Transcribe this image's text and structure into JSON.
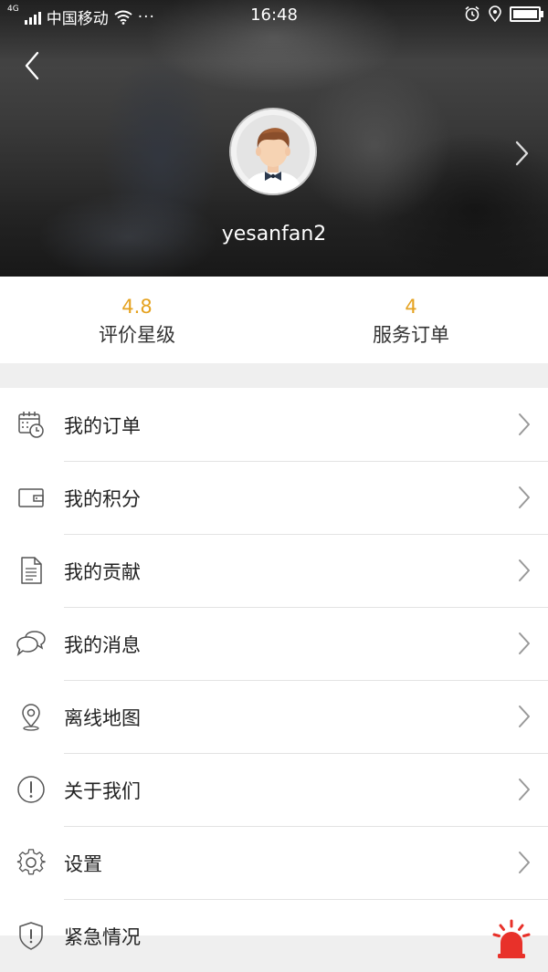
{
  "status_bar": {
    "network": "4G",
    "carrier": "中国移动",
    "dots": "···",
    "time": "16:48"
  },
  "profile": {
    "username": "yesanfan2"
  },
  "stats": [
    {
      "value": "4.8",
      "label": "评价星级"
    },
    {
      "value": "4",
      "label": "服务订单"
    }
  ],
  "menu": [
    {
      "label": "我的订单",
      "icon": "calendar-clock-icon"
    },
    {
      "label": "我的积分",
      "icon": "wallet-icon"
    },
    {
      "label": "我的贡献",
      "icon": "document-icon"
    },
    {
      "label": "我的消息",
      "icon": "chat-bubbles-icon"
    },
    {
      "label": "离线地图",
      "icon": "map-pin-icon"
    },
    {
      "label": "关于我们",
      "icon": "info-exclamation-icon"
    },
    {
      "label": "设置",
      "icon": "gear-icon"
    },
    {
      "label": "紧急情况",
      "icon": "shield-icon"
    }
  ],
  "colors": {
    "accent": "#e5a21f",
    "divider": "#e3e3e3",
    "section_gap": "#efefef",
    "alarm_red": "#e8312a"
  }
}
